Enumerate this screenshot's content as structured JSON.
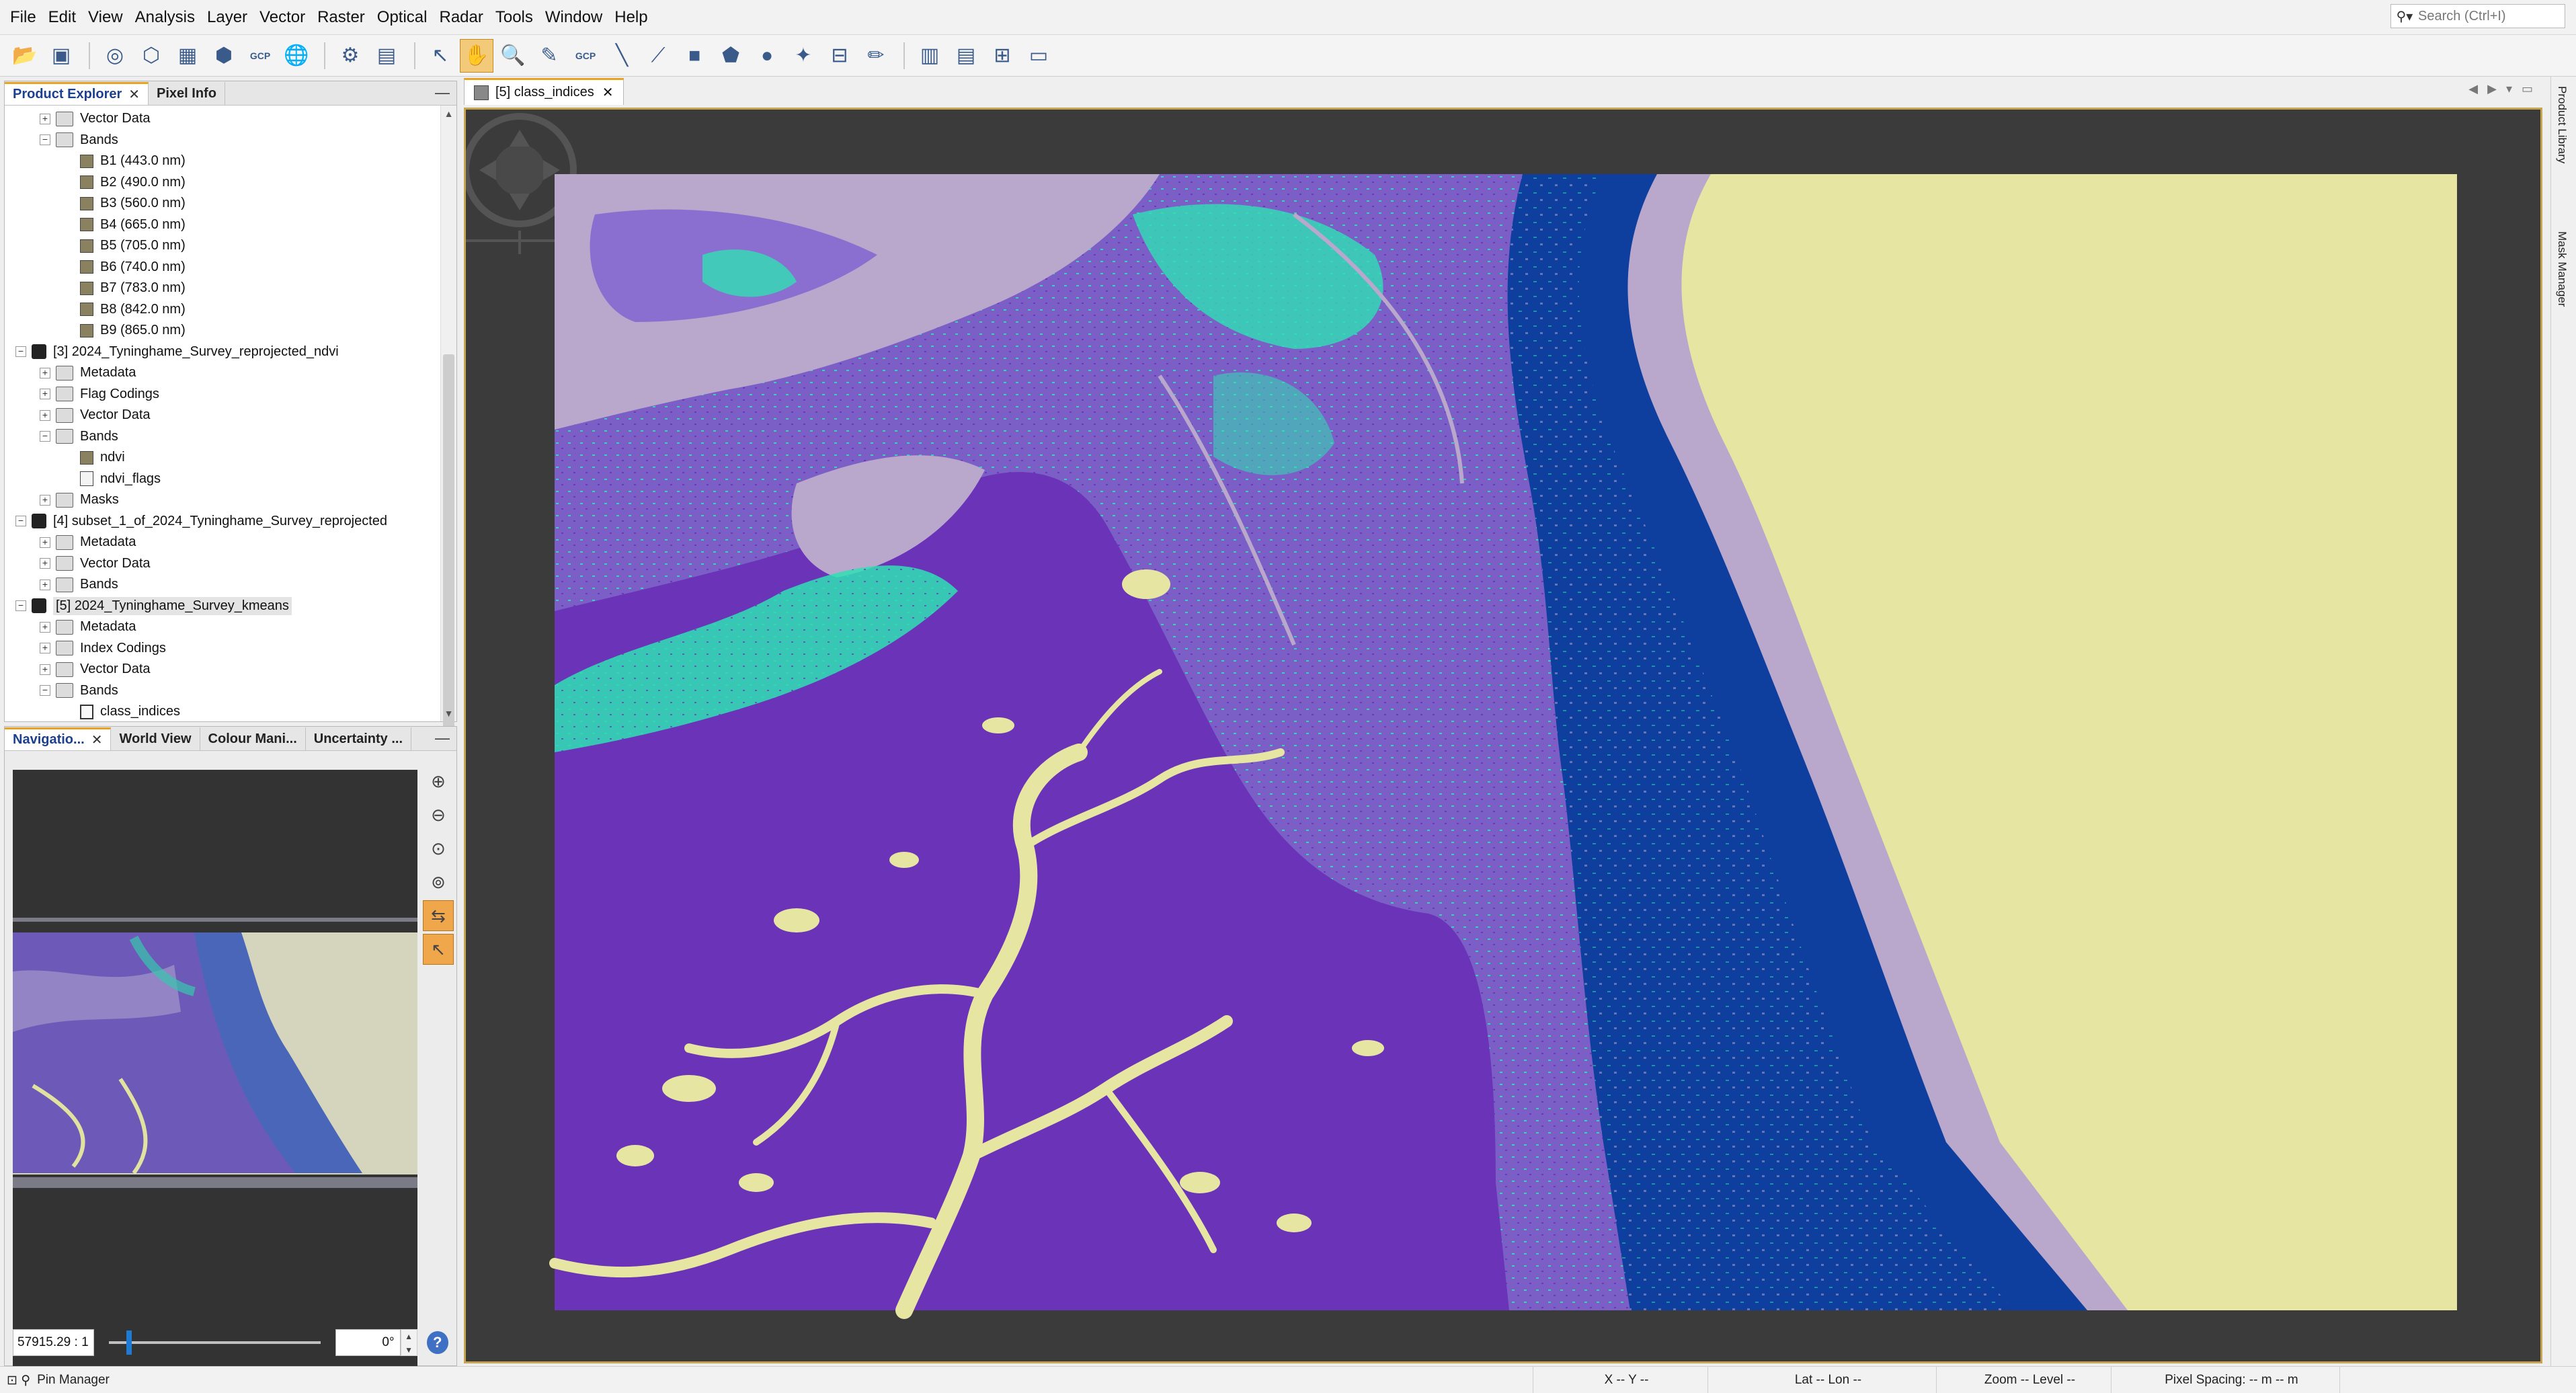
{
  "menu": [
    "File",
    "Edit",
    "View",
    "Analysis",
    "Layer",
    "Vector",
    "Raster",
    "Optical",
    "Radar",
    "Tools",
    "Window",
    "Help"
  ],
  "search": {
    "placeholder": "Search (Ctrl+I)"
  },
  "toolbar_gcp_1": "GCP",
  "toolbar_gcp_2": "GCP",
  "explorer": {
    "tabs": [
      {
        "label": "Product Explorer"
      },
      {
        "label": "Pixel Info"
      }
    ],
    "rows": [
      {
        "label": "Vector Data",
        "level": 1,
        "icon": "folder",
        "expand": "+"
      },
      {
        "label": "Bands",
        "level": 1,
        "icon": "folder",
        "expand": "−"
      },
      {
        "label": "B1 (443.0 nm)",
        "level": 2,
        "icon": "band",
        "expand": ""
      },
      {
        "label": "B2 (490.0 nm)",
        "level": 2,
        "icon": "band",
        "expand": ""
      },
      {
        "label": "B3 (560.0 nm)",
        "level": 2,
        "icon": "band",
        "expand": ""
      },
      {
        "label": "B4 (665.0 nm)",
        "level": 2,
        "icon": "band",
        "expand": ""
      },
      {
        "label": "B5 (705.0 nm)",
        "level": 2,
        "icon": "band",
        "expand": ""
      },
      {
        "label": "B6 (740.0 nm)",
        "level": 2,
        "icon": "band",
        "expand": ""
      },
      {
        "label": "B7 (783.0 nm)",
        "level": 2,
        "icon": "band",
        "expand": ""
      },
      {
        "label": "B8 (842.0 nm)",
        "level": 2,
        "icon": "band",
        "expand": ""
      },
      {
        "label": "B9 (865.0 nm)",
        "level": 2,
        "icon": "band",
        "expand": ""
      },
      {
        "label": "[3] 2024_Tyninghame_Survey_reprojected_ndvi",
        "level": 0,
        "icon": "product",
        "expand": "−"
      },
      {
        "label": "Metadata",
        "level": 1,
        "icon": "folder",
        "expand": "+"
      },
      {
        "label": "Flag Codings",
        "level": 1,
        "icon": "folder",
        "expand": "+"
      },
      {
        "label": "Vector Data",
        "level": 1,
        "icon": "folder",
        "expand": "+"
      },
      {
        "label": "Bands",
        "level": 1,
        "icon": "folder",
        "expand": "−"
      },
      {
        "label": "ndvi",
        "level": 2,
        "icon": "band",
        "expand": ""
      },
      {
        "label": "ndvi_flags",
        "level": 2,
        "icon": "flag",
        "expand": ""
      },
      {
        "label": "Masks",
        "level": 1,
        "icon": "folder",
        "expand": "+"
      },
      {
        "label": "[4] subset_1_of_2024_Tyninghame_Survey_reprojected",
        "level": 0,
        "icon": "product",
        "expand": "−"
      },
      {
        "label": "Metadata",
        "level": 1,
        "icon": "folder",
        "expand": "+"
      },
      {
        "label": "Vector Data",
        "level": 1,
        "icon": "folder",
        "expand": "+"
      },
      {
        "label": "Bands",
        "level": 1,
        "icon": "folder",
        "expand": "+"
      },
      {
        "label": "[5] 2024_Tyninghame_Survey_kmeans",
        "level": 0,
        "icon": "product",
        "expand": "−",
        "selected": true
      },
      {
        "label": "Metadata",
        "level": 1,
        "icon": "folder",
        "expand": "+"
      },
      {
        "label": "Index Codings",
        "level": 1,
        "icon": "folder",
        "expand": "+"
      },
      {
        "label": "Vector Data",
        "level": 1,
        "icon": "folder",
        "expand": "+"
      },
      {
        "label": "Bands",
        "level": 1,
        "icon": "folder",
        "expand": "−"
      },
      {
        "label": "class_indices",
        "level": 2,
        "icon": "idx",
        "expand": ""
      }
    ]
  },
  "nav": {
    "tabs": [
      {
        "label": "Navigatio..."
      },
      {
        "label": "World View"
      },
      {
        "label": "Colour Mani..."
      },
      {
        "label": "Uncertainty ..."
      }
    ],
    "zoom_value": "57915.29 : 1",
    "angle_value": "0°",
    "help": "?"
  },
  "document": {
    "tab_label": "[5] class_indices"
  },
  "right_sidebar": {
    "items": [
      "Product Library",
      "Mask Manager"
    ]
  },
  "status": {
    "pin_manager": "Pin Manager",
    "xy": "X   -- Y   --",
    "latlon": "Lat   -- Lon   --",
    "zoom": "Zoom -- Level --",
    "spacing": "Pixel Spacing: -- m -- m"
  },
  "colors": {
    "class_sand": "#e6e6a2",
    "class_shallow": "#0f3f9e",
    "class_saltmarsh": "#6a33b8",
    "class_veg": "#2fe0b4",
    "class_mudflat": "#b9a8cc",
    "accent": "#e9a321"
  }
}
